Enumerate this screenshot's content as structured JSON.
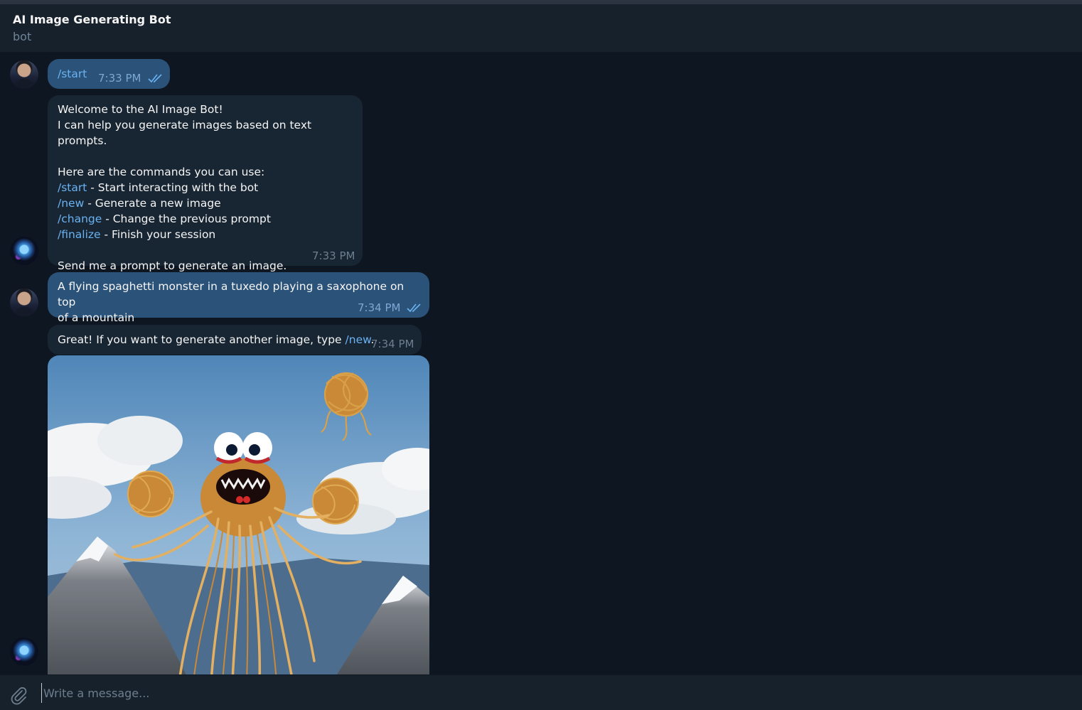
{
  "header": {
    "title": "AI Image Generating Bot",
    "status": "bot"
  },
  "messages": {
    "m1": {
      "text": "/start",
      "time": "7:33 PM"
    },
    "m2": {
      "line1": "Welcome to the AI Image Bot!",
      "line2": "I can help you generate images based on text prompts.",
      "line3": "Here are the commands you can use:",
      "cmd1": "/start",
      "desc1": " - Start interacting with the bot",
      "cmd2": "/new",
      "desc2": " - Generate a new image",
      "cmd3": "/change",
      "desc3": " - Change the previous prompt",
      "cmd4": "/finalize",
      "desc4": " - Finish your session",
      "line4": "Send me a prompt to generate an image.",
      "time": "7:33 PM"
    },
    "m3": {
      "line1": "A flying spaghetti monster in a tuxedo playing a saxophone on top",
      "line2": "of a mountain",
      "time": "7:34 PM"
    },
    "m4": {
      "text": "Great! If you want to generate another image, type ",
      "cmd": "/new",
      "end": ".",
      "time": "7:34 PM"
    }
  },
  "composer": {
    "placeholder": "Write a message..."
  },
  "icons": [
    "attach-icon",
    "double-check-icon"
  ],
  "colors": {
    "background": "#0e1621",
    "header": "#17212b",
    "outgoing_bubble": "#2b5278",
    "incoming_bubble": "#182533",
    "link": "#6ab3f3"
  }
}
